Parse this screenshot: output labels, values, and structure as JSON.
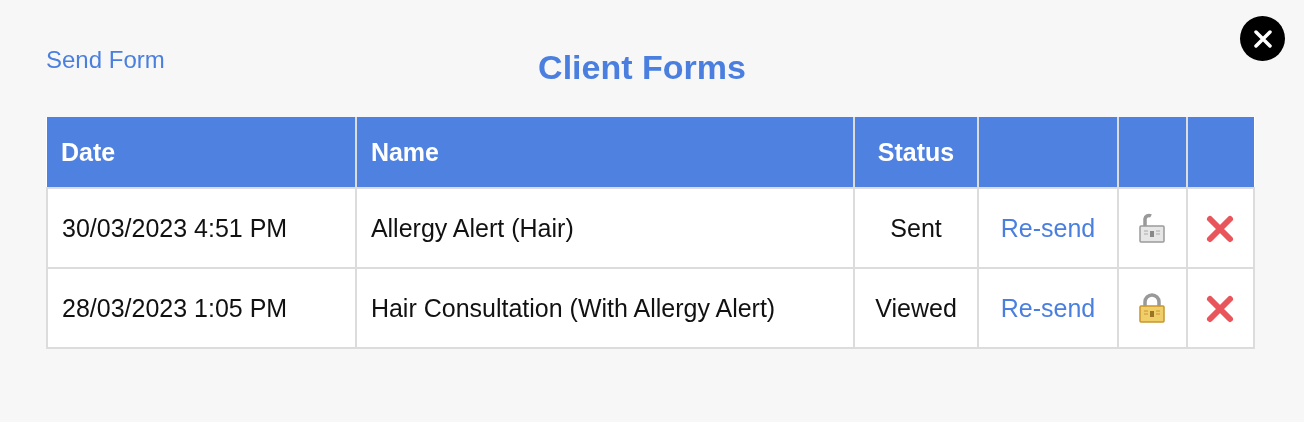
{
  "send_form_link": "Send Form",
  "title": "Client Forms",
  "table": {
    "columns": [
      "Date",
      "Name",
      "Status"
    ],
    "rows": [
      {
        "date": "30/03/2023 4:51 PM",
        "name": "Allergy Alert (Hair)",
        "status": "Sent",
        "action": "Re-send",
        "locked": false
      },
      {
        "date": "28/03/2023 1:05 PM",
        "name": "Hair Consultation (With Allergy Alert)",
        "status": "Viewed",
        "action": "Re-send",
        "locked": true
      }
    ]
  }
}
